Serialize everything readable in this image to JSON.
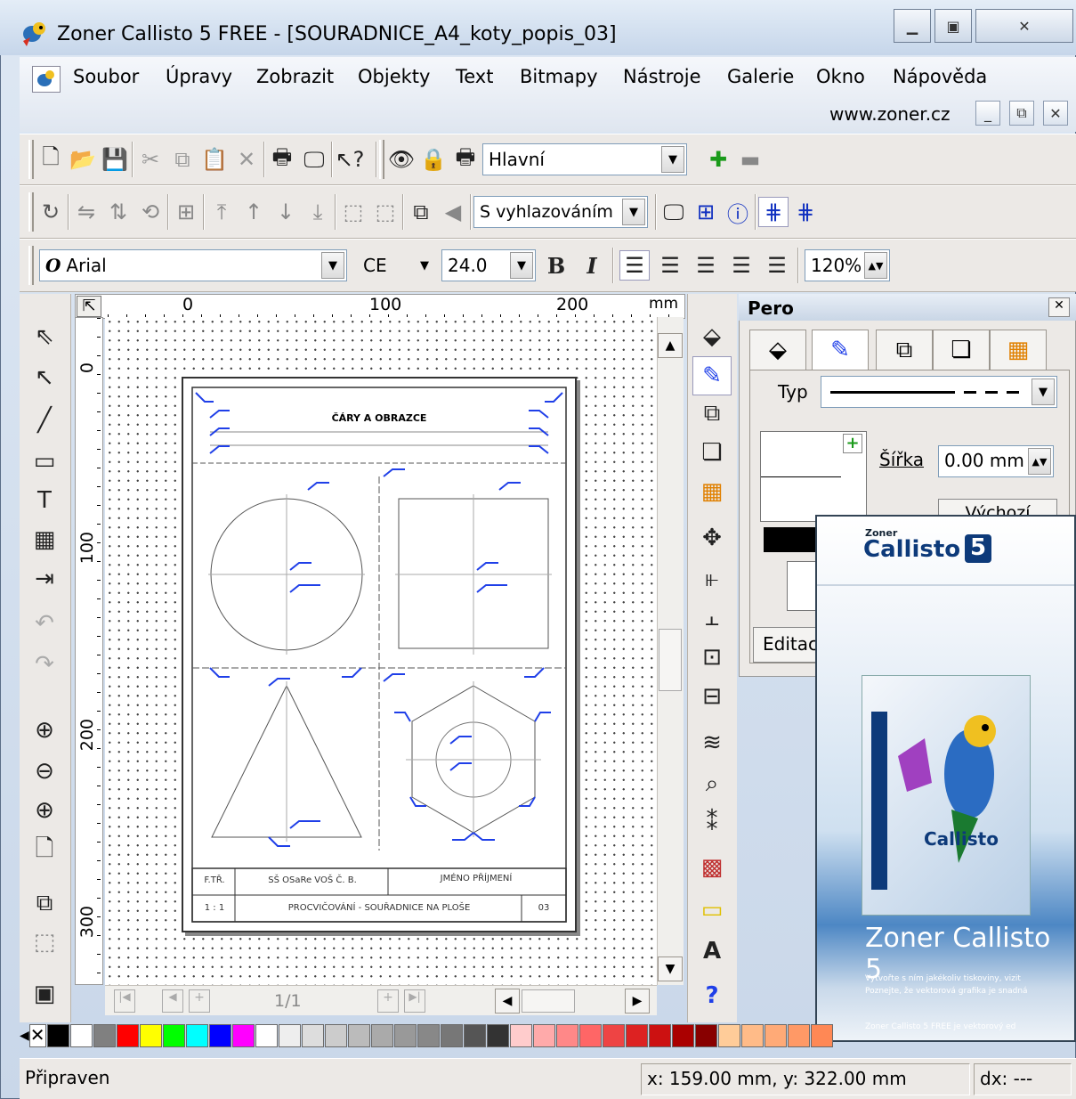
{
  "window": {
    "title": "Zoner Callisto 5 FREE - [SOURADNICE_A4_koty_popis_03]"
  },
  "menu": {
    "items": [
      "Soubor",
      "Úpravy",
      "Zobrazit",
      "Objekty",
      "Text",
      "Bitmapy",
      "Nástroje",
      "Galerie",
      "Okno",
      "Nápověda"
    ],
    "url": "www.zoner.cz"
  },
  "toolbar1": {
    "layer_select": "Hlavní"
  },
  "toolbar2": {
    "render_select": "S vyhlazováním"
  },
  "toolbar3": {
    "font": "Arial",
    "font_glyph": "O",
    "charset": "CE",
    "size": "24.0",
    "bold": "B",
    "italic": "I",
    "zoom": "120%"
  },
  "ruler": {
    "h_labels": [
      "0",
      "100",
      "200"
    ],
    "unit": "mm",
    "v_labels": [
      "0",
      "100",
      "200",
      "300"
    ]
  },
  "drawing": {
    "title": "ČÁRY A OBRAZCE",
    "table": {
      "r1c1": "F.TŘ.",
      "r1c2": "SŠ OSaRe VOŠ Č. B.",
      "r1c3": "JMÉNO PŘÍJMENÍ",
      "r2c1": "1 : 1",
      "r2c2": "PROCVIČOVÁNÍ - SOUŘADNICE NA PLOŠE",
      "r2c3": "03"
    }
  },
  "hscroll": {
    "page": "1/1"
  },
  "pero_panel": {
    "title": "Pero",
    "type_label": "Typ",
    "width_label": "Šířka",
    "width_value": "0.00 mm",
    "default_button": "Výchozí",
    "edit_label": "Editac"
  },
  "splash": {
    "logo_small": "Zoner",
    "logo": "Callisto",
    "version": "5",
    "heading": "Zoner Callisto 5",
    "line1": "Vytvořte s ním jakékoliv tiskoviny, vizit",
    "line2": "Poznejte, že vektorová grafika je snadná",
    "line3": "Zoner Callisto 5 FREE je vektorový ed"
  },
  "status": {
    "text": "Připraven",
    "coords": "x: 159.00 mm, y: 322.00 mm",
    "dx": "dx: ---"
  },
  "palette": [
    "#000000",
    "#ffffff",
    "#808080",
    "#ff0000",
    "#ffff00",
    "#00ff00",
    "#00ffff",
    "#0000ff",
    "#ff00ff",
    "#ffffff",
    "#eeeeee",
    "#dddddd",
    "#cccccc",
    "#bbbbbb",
    "#aaaaaa",
    "#999999",
    "#888888",
    "#777777",
    "#555555",
    "#333333",
    "#ffcccc",
    "#ffaaaa",
    "#ff8888",
    "#ff6666",
    "#ee4444",
    "#dd2222",
    "#cc1111",
    "#aa0000",
    "#880000",
    "#ffcc99",
    "#ffbb88",
    "#ffaa77",
    "#ff9966",
    "#ff8855"
  ]
}
